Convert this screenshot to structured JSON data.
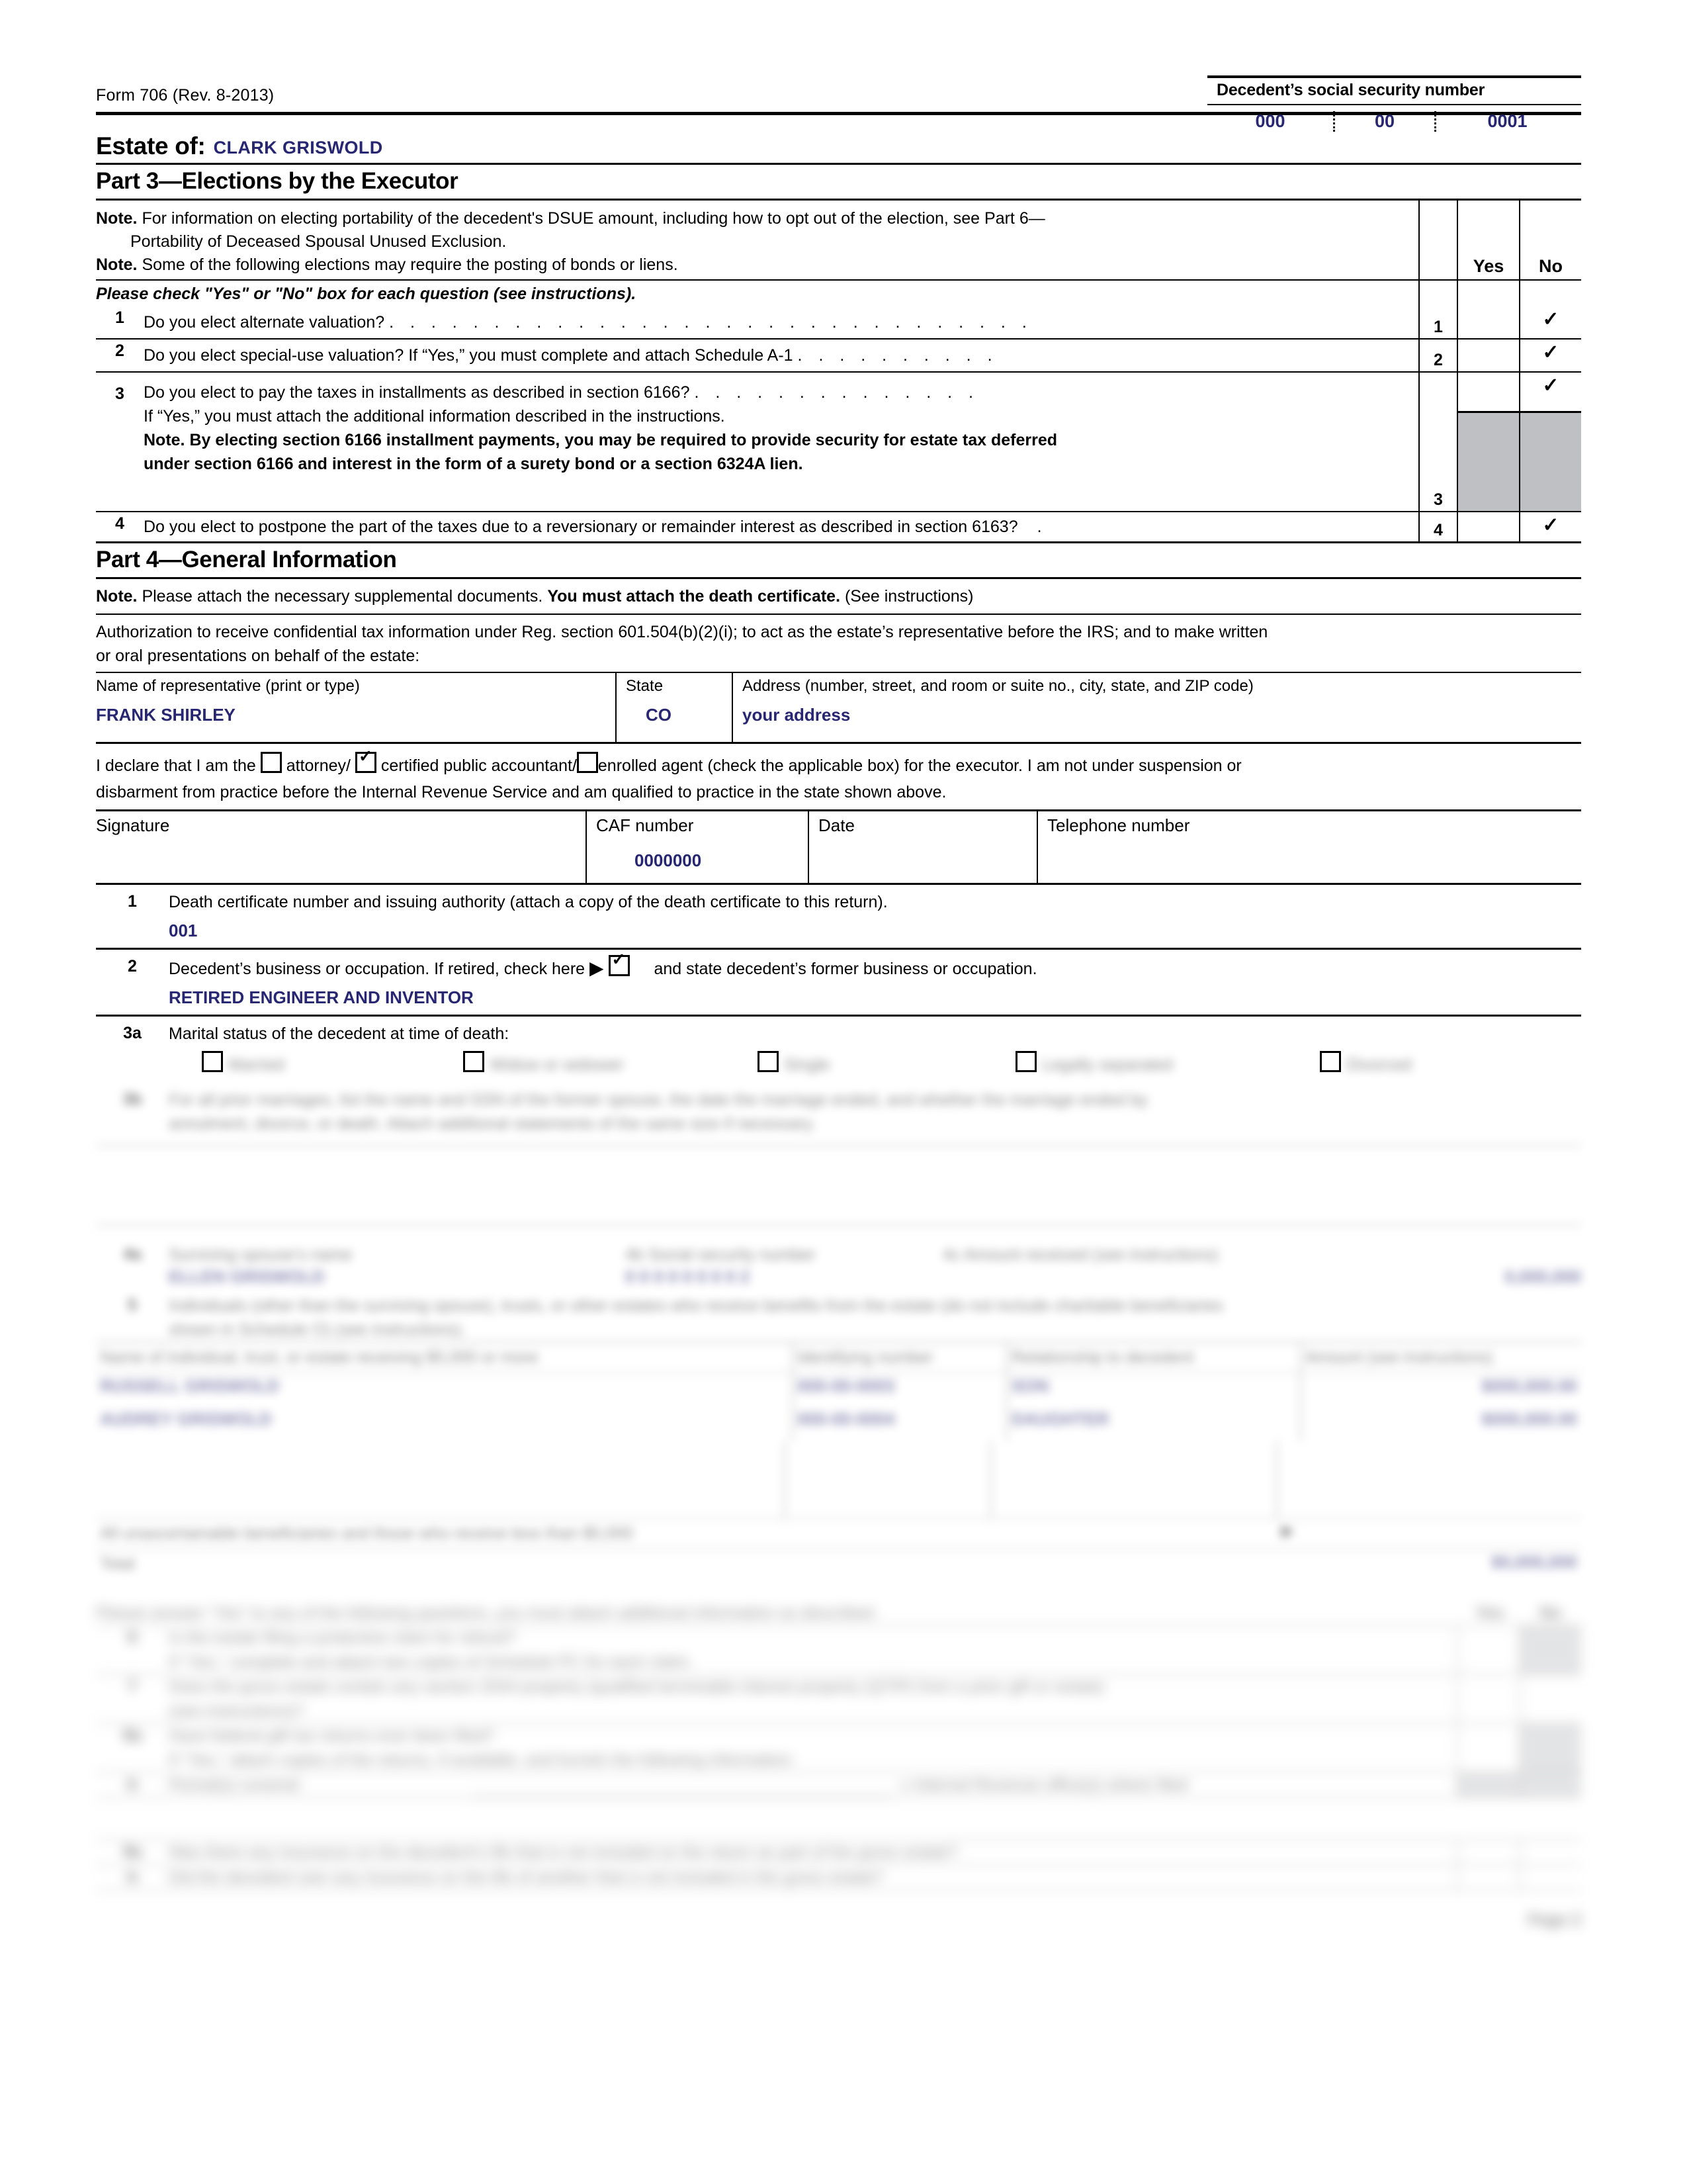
{
  "header": {
    "form_number": "Form 706 (Rev. 8-2013)",
    "estate_of_label": "Estate of:",
    "estate_of_value": "CLARK GRISWOLD",
    "ssn_label": "Decedent’s social security number",
    "ssn_area": "000",
    "ssn_group": "00",
    "ssn_serial": "0001"
  },
  "part3": {
    "title": "Part 3—Elections by the Executor",
    "note1_bold": "Note.",
    "note1_text": "For information on electing portability of the decedent's DSUE amount, including how to opt out of the election, see Part 6—",
    "note1_cont": "Portability of Deceased Spousal Unused Exclusion.",
    "note2_bold": "Note.",
    "note2_text": "Some of the following elections may require the posting of bonds or liens.",
    "yes_header": "Yes",
    "no_header": "No",
    "instruction": "Please check \"Yes\" or \"No\" box for each question (see instructions).",
    "checkmark": "✓",
    "questions": [
      {
        "num": "1",
        "text": "Do you elect alternate valuation?",
        "leader": ". . . . . . . . . . . . . . . . . . . . . . . . . . . . . . .",
        "line_num": "1",
        "yes": "",
        "no": "✓"
      },
      {
        "num": "2",
        "text": "Do you elect special-use valuation? If “Yes,” you must complete and attach Schedule A-1",
        "leader": ". . . . . . . . . .",
        "line_num": "2",
        "yes": "",
        "no": "✓"
      },
      {
        "num": "3",
        "text": "Do you elect to pay the taxes in installments as described in section 6166?",
        "leader": ". . . . . . . . . . . . . .",
        "sub1": "If “Yes,” you must attach the additional information described in the instructions.",
        "sub2": "Note. By electing section 6166 installment payments, you may be required to provide security for estate tax deferred",
        "sub3": "under section 6166 and interest in the form of a surety bond or a section 6324A lien.",
        "line_num": "3",
        "yes": "",
        "no": "✓"
      },
      {
        "num": "4",
        "text": "Do you elect to postpone the part of the taxes due to a reversionary or remainder interest as described in section 6163?",
        "leader": ".",
        "line_num": "4",
        "yes": "",
        "no": "✓"
      }
    ]
  },
  "part4": {
    "title": "Part 4—General Information",
    "note_bold": "Note.",
    "note_text_1": "Please attach the necessary supplemental documents.",
    "note_text_bold": "You must attach the death certificate.",
    "note_text_2": "(See instructions)",
    "auth_line1": "Authorization to receive confidential tax information under Reg. section 601.504(b)(2)(i); to act as the estate’s representative before the IRS; and to make written",
    "auth_line2": "or oral presentations on behalf of the estate:",
    "rep": {
      "name_label": "Name of representative (print or type)",
      "name_value": "FRANK SHIRLEY",
      "state_label": "State",
      "state_value": "CO",
      "address_label": "Address (number, street, and room or suite no., city, state, and ZIP code)",
      "address_value": "your address"
    },
    "declare": {
      "pre": "I declare that I am the",
      "opt1": "attorney/",
      "opt1_checked": false,
      "opt2": "certified public accountant/",
      "opt2_checked": true,
      "opt3": "enrolled agent",
      "opt3_checked": false,
      "post": "(check the applicable box) for the executor. I am not under suspension or",
      "line2": "disbarment from practice before the Internal Revenue Service and am qualified to practice in the state shown above."
    },
    "sig_row": {
      "signature_label": "Signature",
      "signature_value": "",
      "caf_label": "CAF number",
      "caf_value": "0000000",
      "date_label": "Date",
      "date_value": "",
      "phone_label": "Telephone number",
      "phone_value": ""
    },
    "item1": {
      "num": "1",
      "text": "Death certificate number and issuing authority (attach a copy of the death certificate to this return).",
      "value": "001"
    },
    "item2": {
      "num": "2",
      "text_a": "Decedent’s business or occupation. If retired, check here",
      "arrow": "▶",
      "checked": true,
      "text_b": "and state decedent’s former business or occupation.",
      "value": "RETIRED ENGINEER AND INVENTOR"
    },
    "item3a": {
      "num": "3a",
      "text": "Marital status of the decedent at time of death:",
      "options": [
        "Married",
        "Widow or widower",
        "Single",
        "Legally separated",
        "Divorced"
      ]
    },
    "item3b": {
      "num": "3b",
      "line1": "For all prior marriages, list the name and SSN of the former spouse, the date the marriage ended, and whether the marriage ended by",
      "line2": "annulment, divorce, or death. Attach additional statements of the same size if necessary."
    },
    "item4": {
      "num": "4a",
      "label_a": "Surviving spouse’s name",
      "value_a": "ELLEN GRISWOLD",
      "label_b": "4b Social security number",
      "value_b": "0 0 0   0 0   0 0 0 2",
      "label_c": "4c Amount received (see instructions)",
      "value_c": "0,000,000"
    },
    "item5": {
      "num": "5",
      "line1": "Individuals (other than the surviving spouse), trusts, or other estates who receive benefits from the estate (do not include charitable beneficiaries",
      "line2": "shown in Schedule O) (see instructions).",
      "columns": [
        "Name of individual, trust, or estate receiving $5,000 or more",
        "Identifying number",
        "Relationship to decedent",
        "Amount (see instructions)"
      ],
      "rows": [
        {
          "name": "RUSSELL GRISWOLD",
          "id": "000-00-0003",
          "relationship": "SON",
          "amount": "$000,000.00"
        },
        {
          "name": "AUDREY GRISWOLD",
          "id": "000-00-0004",
          "relationship": "DAUGHTER",
          "amount": "$000,000.00"
        },
        {
          "name": "",
          "id": "",
          "relationship": "",
          "amount": ""
        },
        {
          "name": "",
          "id": "",
          "relationship": "",
          "amount": ""
        }
      ],
      "allother_label": "All unascertainable beneficiaries and those who receive less than $5,000",
      "allother_arrow": "▶",
      "total_label": "Total",
      "total_value": "$0,000,000"
    },
    "final": {
      "lead": "Please answer “Yes” to any of the following questions, you must attach additional information as described.",
      "yes_header": "Yes",
      "no_header": "No",
      "rows": [
        {
          "num": "6",
          "text": "Is the estate filing a protective claim for refund?",
          "sub": "If “Yes,” complete and attach two copies of Schedule PC for each claim."
        },
        {
          "num": "7",
          "text": "Does the gross estate contain any section 2044 property (qualified terminable interest property (QTIP) from a prior gift or estate)",
          "sub": "(see instructions)?"
        },
        {
          "num": "8a",
          "text": "Have federal gift tax returns ever been filed?",
          "sub": "If “Yes,” attach copies of the returns, if available, and furnish the following information:"
        },
        {
          "num": "b",
          "text": "Period(s) covered",
          "text2": "c Internal Revenue office(s) where filed"
        },
        {
          "num": "9a",
          "text": "Was there any insurance on the decedent’s life that is not included on the return as part of the gross estate?"
        },
        {
          "num": "b",
          "text": "Did the decedent own any insurance on the life of another that is not included in the gross estate?"
        }
      ]
    },
    "footer_page": "Page 2"
  }
}
